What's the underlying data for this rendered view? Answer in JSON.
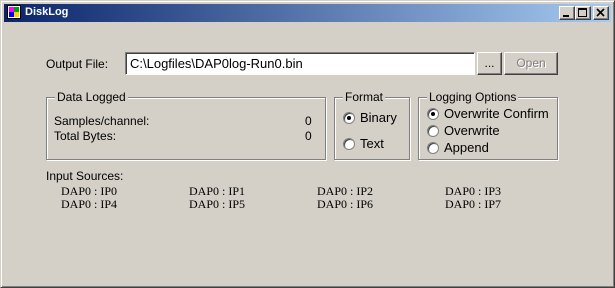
{
  "window": {
    "title": "DiskLog",
    "controls": {
      "minimize": "minimize-icon",
      "maximize": "maximize-icon",
      "close": "close-icon"
    }
  },
  "output": {
    "label": "Output File:",
    "value": "C:\\Logfiles\\DAP0log-Run0.bin",
    "browse_label": "...",
    "open_label": "Open"
  },
  "data_logged": {
    "title": "Data Logged",
    "samples_label": "Samples/channel:",
    "samples_value": "0",
    "bytes_label": "Total Bytes:",
    "bytes_value": "0"
  },
  "format": {
    "title": "Format",
    "options": [
      {
        "label": "Binary",
        "selected": true
      },
      {
        "label": "Text",
        "selected": false
      }
    ]
  },
  "logging_options": {
    "title": "Logging Options",
    "options": [
      {
        "label": "Overwrite Confirm",
        "selected": true
      },
      {
        "label": "Overwrite",
        "selected": false
      },
      {
        "label": "Append",
        "selected": false
      }
    ]
  },
  "input_sources": {
    "label": "Input Sources:",
    "items": [
      "DAP0 : IP0",
      "DAP0 : IP1",
      "DAP0 : IP2",
      "DAP0 : IP3",
      "DAP0 : IP4",
      "DAP0 : IP5",
      "DAP0 : IP6",
      "DAP0 : IP7"
    ]
  },
  "colors": {
    "titlebar_start": "#0a246a",
    "titlebar_end": "#a6caf0",
    "face": "#d4d0c8"
  }
}
